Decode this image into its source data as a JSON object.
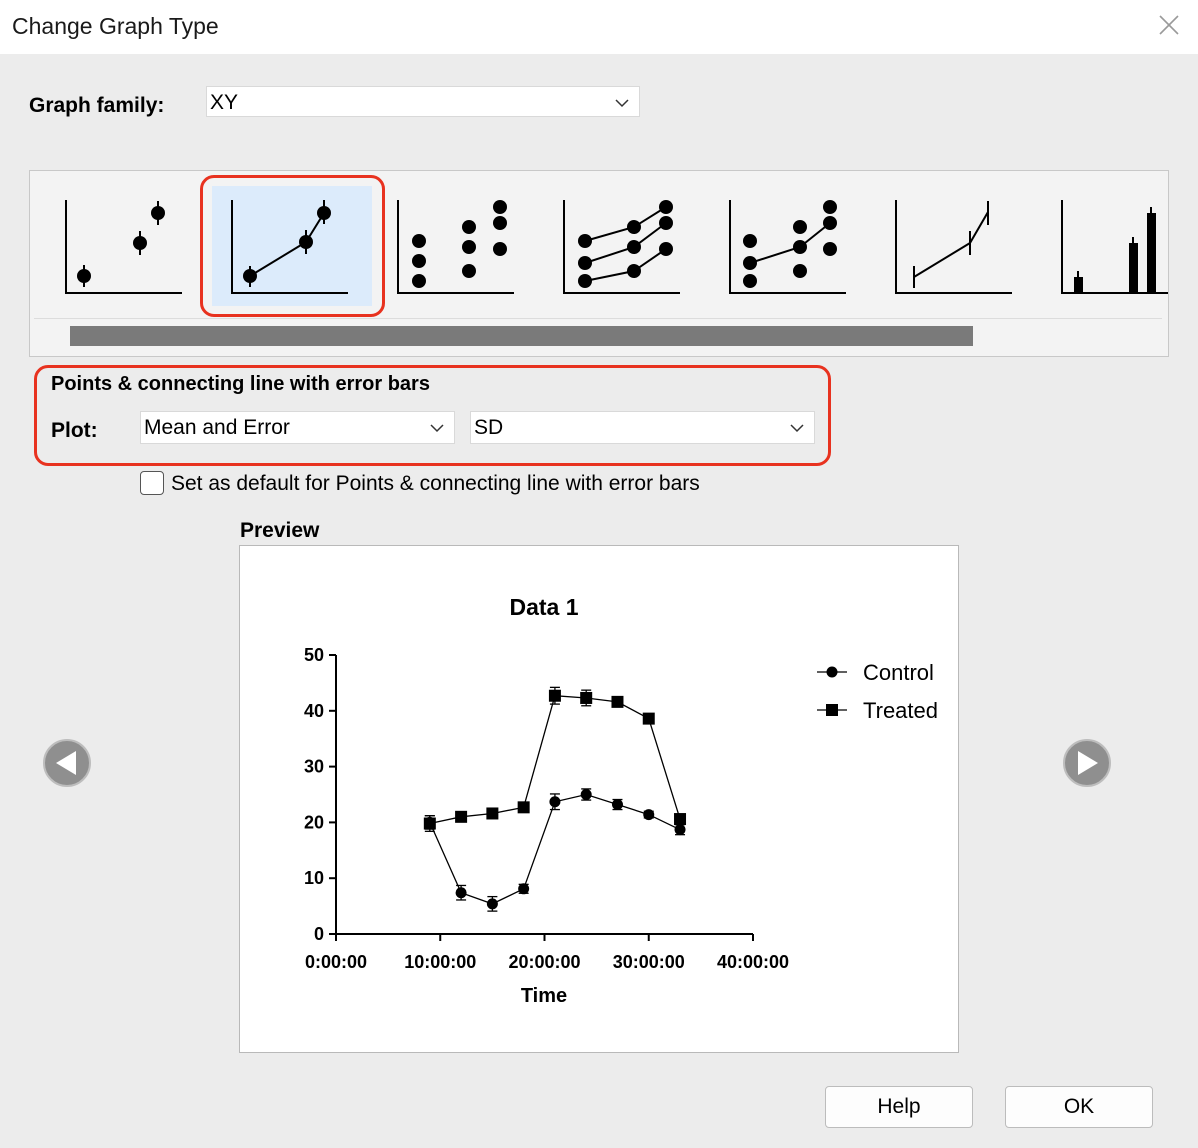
{
  "window": {
    "title": "Change Graph Type"
  },
  "graph_family": {
    "label": "Graph family:",
    "value": "XY"
  },
  "gallery": {
    "items": [
      {
        "name": "points-with-error-bars"
      },
      {
        "name": "points-connecting-line-error-bars",
        "selected": true
      },
      {
        "name": "scatter-columns"
      },
      {
        "name": "multiple-lines-points"
      },
      {
        "name": "points-some-connected"
      },
      {
        "name": "line-with-error-bars"
      },
      {
        "name": "bars-with-error-bars"
      }
    ]
  },
  "selection": {
    "heading": "Points & connecting line with error bars",
    "plot_label": "Plot:",
    "plot_value": "Mean and Error",
    "error_value": "SD"
  },
  "default_checkbox": {
    "label": "Set as default for Points & connecting line with error bars",
    "checked": false
  },
  "preview": {
    "label": "Preview"
  },
  "buttons": {
    "help": "Help",
    "ok": "OK"
  },
  "chart_data": {
    "type": "line",
    "title": "Data 1",
    "xlabel": "Time",
    "ylabel": "",
    "xlim": [
      0,
      40
    ],
    "ylim": [
      0,
      50
    ],
    "x_ticks": [
      0,
      10,
      20,
      30,
      40
    ],
    "x_tick_labels": [
      "0:00:00",
      "10:00:00",
      "20:00:00",
      "30:00:00",
      "40:00:00"
    ],
    "y_ticks": [
      0,
      10,
      20,
      30,
      40,
      50
    ],
    "y_tick_labels": [
      "0",
      "10",
      "20",
      "30",
      "40",
      "50"
    ],
    "legend_position": "top-right",
    "x": [
      "9:00:00",
      "12:00:00",
      "15:00:00",
      "18:00:00",
      "21:00:00",
      "24:00:00",
      "27:00:00",
      "30:00:00",
      "33:00:00"
    ],
    "x_hours": [
      9,
      12,
      15,
      18,
      21,
      24,
      27,
      30,
      33
    ],
    "series": [
      {
        "name": "Control",
        "marker": "circle",
        "values": [
          20,
          7.4,
          5.4,
          8.1,
          23.7,
          25,
          23.2,
          21.4,
          18.7
        ],
        "sd": [
          1.2,
          1.3,
          1.3,
          0.8,
          1.4,
          1.0,
          0.9,
          0.6,
          0.9
        ]
      },
      {
        "name": "Treated",
        "marker": "square",
        "values": [
          19.8,
          21,
          21.6,
          22.7,
          42.7,
          42.3,
          41.6,
          38.6,
          20.6
        ],
        "sd": [
          1.4,
          0.6,
          0.7,
          0.6,
          1.5,
          1.4,
          0.8,
          0.6,
          0.8
        ]
      }
    ]
  }
}
